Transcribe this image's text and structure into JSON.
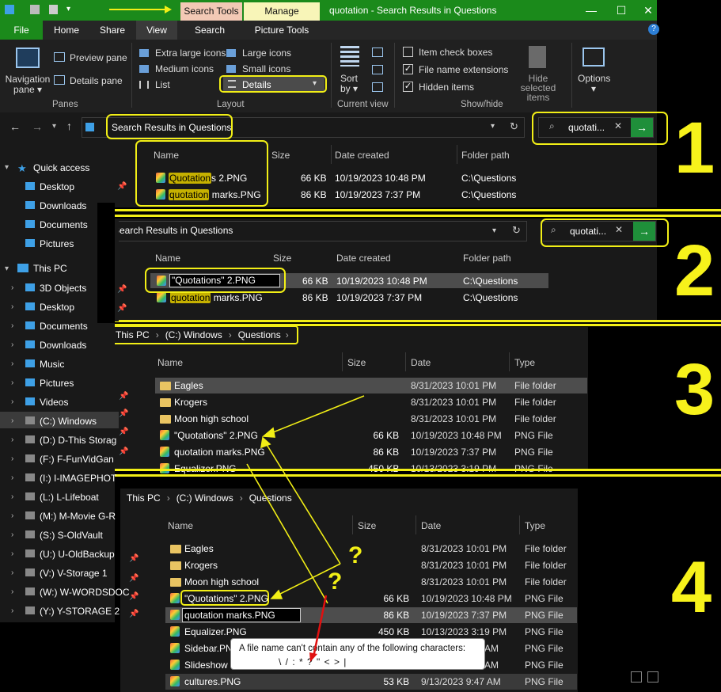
{
  "title_bar": {
    "context_tabs": {
      "picture_tools": "Search Tools",
      "manage": "Manage"
    },
    "window_title": "quotation - Search Results in Questions",
    "minimize": "—",
    "maximize": "☐",
    "close": "✕"
  },
  "tabs": {
    "file": "File",
    "home": "Home",
    "share": "Share",
    "view": "View",
    "search": "Search",
    "picture_tools": "Picture Tools",
    "help": "?"
  },
  "ribbon": {
    "navigation_pane": "Navigation\npane ▾",
    "preview_pane": "Preview pane",
    "details_pane": "Details pane",
    "panes_group": "Panes",
    "layout": {
      "extra_large_icons": "Extra large icons",
      "large_icons": "Large icons",
      "medium_icons": "Medium icons",
      "small_icons": "Small icons",
      "list": "List",
      "details": "Details",
      "group": "Layout"
    },
    "sort_by": "Sort\nby ▾",
    "current_view_group": "Current view",
    "item_check_boxes": "Item check boxes",
    "file_name_extensions": "File name extensions",
    "hidden_items": "Hidden items",
    "hide_selected_items": "Hide selected\nitems",
    "options": "Options\n▾",
    "show_hide_group": "Show/hide",
    "checks": {
      "item_check_boxes": false,
      "file_name_extensions": true,
      "hidden_items": true
    }
  },
  "panel1": {
    "address": "Search Results in Questions",
    "search_value": "quotati...",
    "columns": {
      "name": "Name",
      "size": "Size",
      "date_created": "Date created",
      "folder_path": "Folder path"
    },
    "rows": [
      {
        "name_hl": "Quotation",
        "name_rest": "s 2.PNG",
        "size": "66 KB",
        "date": "10/19/2023 10:48 PM",
        "path": "C:\\Questions"
      },
      {
        "name_hl": "quotation",
        "name_rest": " marks.PNG",
        "size": "86 KB",
        "date": "10/19/2023 7:37 PM",
        "path": "C:\\Questions"
      }
    ],
    "number": "1"
  },
  "panel2": {
    "address": "Search Results in Questions",
    "search_value": "quotati...",
    "columns": {
      "name": "Name",
      "size": "Size",
      "date_created": "Date created",
      "folder_path": "Folder path"
    },
    "rows": [
      {
        "name_edit": "\"Quotations\" 2.PNG",
        "size": "66 KB",
        "date": "10/19/2023 10:48 PM",
        "path": "C:\\Questions"
      },
      {
        "name_hl": "quotation",
        "name_rest": " marks.PNG",
        "size": "86 KB",
        "date": "10/19/2023 7:37 PM",
        "path": "C:\\Questions"
      }
    ],
    "number": "2"
  },
  "panel3": {
    "breadcrumb": [
      "This PC",
      "(C:) Windows",
      "Questions"
    ],
    "columns": {
      "name": "Name",
      "size": "Size",
      "date": "Date",
      "type": "Type"
    },
    "rows": [
      {
        "name": "Eagles",
        "size": "",
        "date": "8/31/2023 10:01 PM",
        "type": "File folder",
        "kind": "folder"
      },
      {
        "name": "Krogers",
        "size": "",
        "date": "8/31/2023 10:01 PM",
        "type": "File folder",
        "kind": "folder"
      },
      {
        "name": "Moon high school",
        "size": "",
        "date": "8/31/2023 10:01 PM",
        "type": "File folder",
        "kind": "folder"
      },
      {
        "name": "\"Quotations\" 2.PNG",
        "size": "66 KB",
        "date": "10/19/2023 10:48 PM",
        "type": "PNG File",
        "kind": "png"
      },
      {
        "name": "quotation marks.PNG",
        "size": "86 KB",
        "date": "10/19/2023 7:37 PM",
        "type": "PNG File",
        "kind": "png"
      },
      {
        "name": "Equalizer.PNG",
        "size": "450 KB",
        "date": "10/13/2023 3:19 PM",
        "type": "PNG File",
        "kind": "png"
      }
    ],
    "number": "3"
  },
  "panel4": {
    "breadcrumb": [
      "This PC",
      "(C:) Windows",
      "Questions"
    ],
    "columns": {
      "name": "Name",
      "size": "Size",
      "date": "Date",
      "type": "Type"
    },
    "rows": [
      {
        "name": "Eagles",
        "size": "",
        "date": "8/31/2023 10:01 PM",
        "type": "File folder",
        "kind": "folder"
      },
      {
        "name": "Krogers",
        "size": "",
        "date": "8/31/2023 10:01 PM",
        "type": "File folder",
        "kind": "folder"
      },
      {
        "name": "Moon high school",
        "size": "",
        "date": "8/31/2023 10:01 PM",
        "type": "File folder",
        "kind": "folder"
      },
      {
        "name": "\"Quotations\" 2.PNG",
        "size": "66 KB",
        "date": "10/19/2023 10:48 PM",
        "type": "PNG File",
        "kind": "png"
      },
      {
        "name": "quotation marks.PNG",
        "size": "86 KB",
        "date": "10/19/2023 7:37 PM",
        "type": "PNG File",
        "kind": "png"
      },
      {
        "name": "Equalizer.PNG",
        "size": "450 KB",
        "date": "10/13/2023 3:19 PM",
        "type": "PNG File",
        "kind": "png"
      },
      {
        "name": "Sidebar.PN",
        "size": "",
        "date": "AM",
        "type": "PNG File",
        "kind": "png"
      },
      {
        "name": "Slideshow",
        "size": "",
        "date": "AM",
        "type": "PNG File",
        "kind": "png"
      },
      {
        "name": "cultures.PNG",
        "size": "53 KB",
        "date": "9/13/2023 9:47 AM",
        "type": "PNG File",
        "kind": "png"
      }
    ],
    "tooltip_line1": "A file name can't contain any of the following characters:",
    "tooltip_line2": "\\ / : * ? \" < > |",
    "question_marks": [
      "?",
      "?"
    ],
    "number": "4"
  },
  "sidebar": {
    "quick_access": "Quick access",
    "quick_items": [
      "Desktop",
      "Downloads",
      "Documents",
      "Pictures"
    ],
    "this_pc": "This PC",
    "pc_items": [
      "3D Objects",
      "Desktop",
      "Documents",
      "Downloads",
      "Music",
      "Pictures",
      "Videos",
      "(C:) Windows",
      "(D:) D-This Storag",
      "(F:) F-FunVidGan",
      "(I:) I-IMAGEPHOT",
      "(L:) L-Lifeboat",
      "(M:) M-Movie G-R",
      "(S:) S-OldVault",
      "(U:) U-OldBackup",
      "(V:) V-Storage 1",
      "(W:) W-WORDSDOC",
      "(Y:) Y-STORAGE 2"
    ]
  },
  "colors": {
    "accent": "#1b8a1b",
    "highlight_yellow": "#f2ef16",
    "search_go": "#1f8f3a"
  }
}
